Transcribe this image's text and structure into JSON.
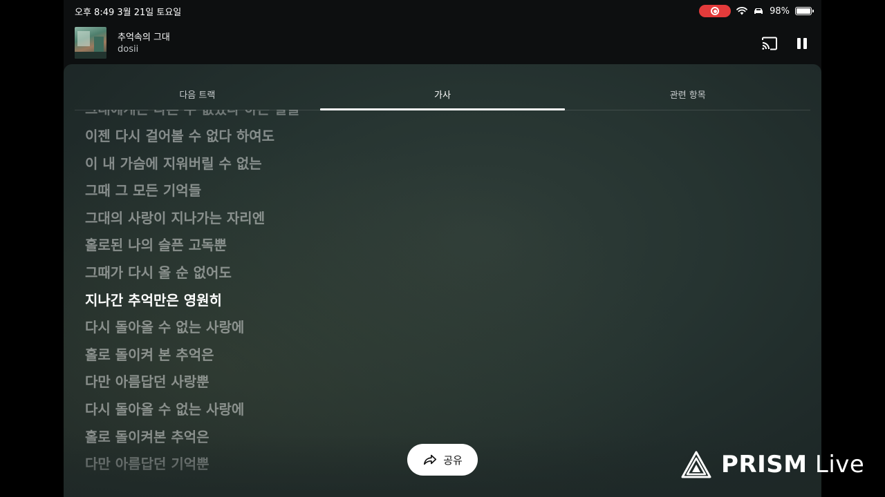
{
  "status_bar": {
    "time": "오후 8:49   3월 21일 토요일",
    "battery_pct": "98%",
    "battery_level": 0.98
  },
  "now_playing": {
    "title": "추억속의 그대",
    "artist": "dosii"
  },
  "tabs": [
    {
      "label": "다음 트랙",
      "active": false
    },
    {
      "label": "가사",
      "active": true
    },
    {
      "label": "관련 항목",
      "active": false
    }
  ],
  "lyrics": {
    "partial_top": "그대에게는 다른 수 없었다 하는 말을",
    "lines": [
      "이젠 다시 걸어볼 수 없다 하여도",
      "이 내 가슴에 지워버릴 수 없는",
      "그때 그 모든 기억들",
      "그대의 사랑이 지나가는 자리엔",
      "홀로된 나의 슬픈 고독뿐",
      "그때가 다시 올 순 없어도",
      "지나간 추억만은 영원히",
      "다시 돌아올 수 없는 사랑에",
      "홀로 돌이켜 본 추억은",
      "다만 아름답던 사랑뿐",
      "다시 돌아올 수 없는 사랑에",
      "홀로 돌이켜본 추억은",
      "다만 아름답던 기억뿐"
    ],
    "current_index": 6
  },
  "share_button": {
    "label": "공유",
    "icon": "share-icon"
  },
  "watermark": {
    "brand": "PRISM",
    "suffix": "Live"
  }
}
